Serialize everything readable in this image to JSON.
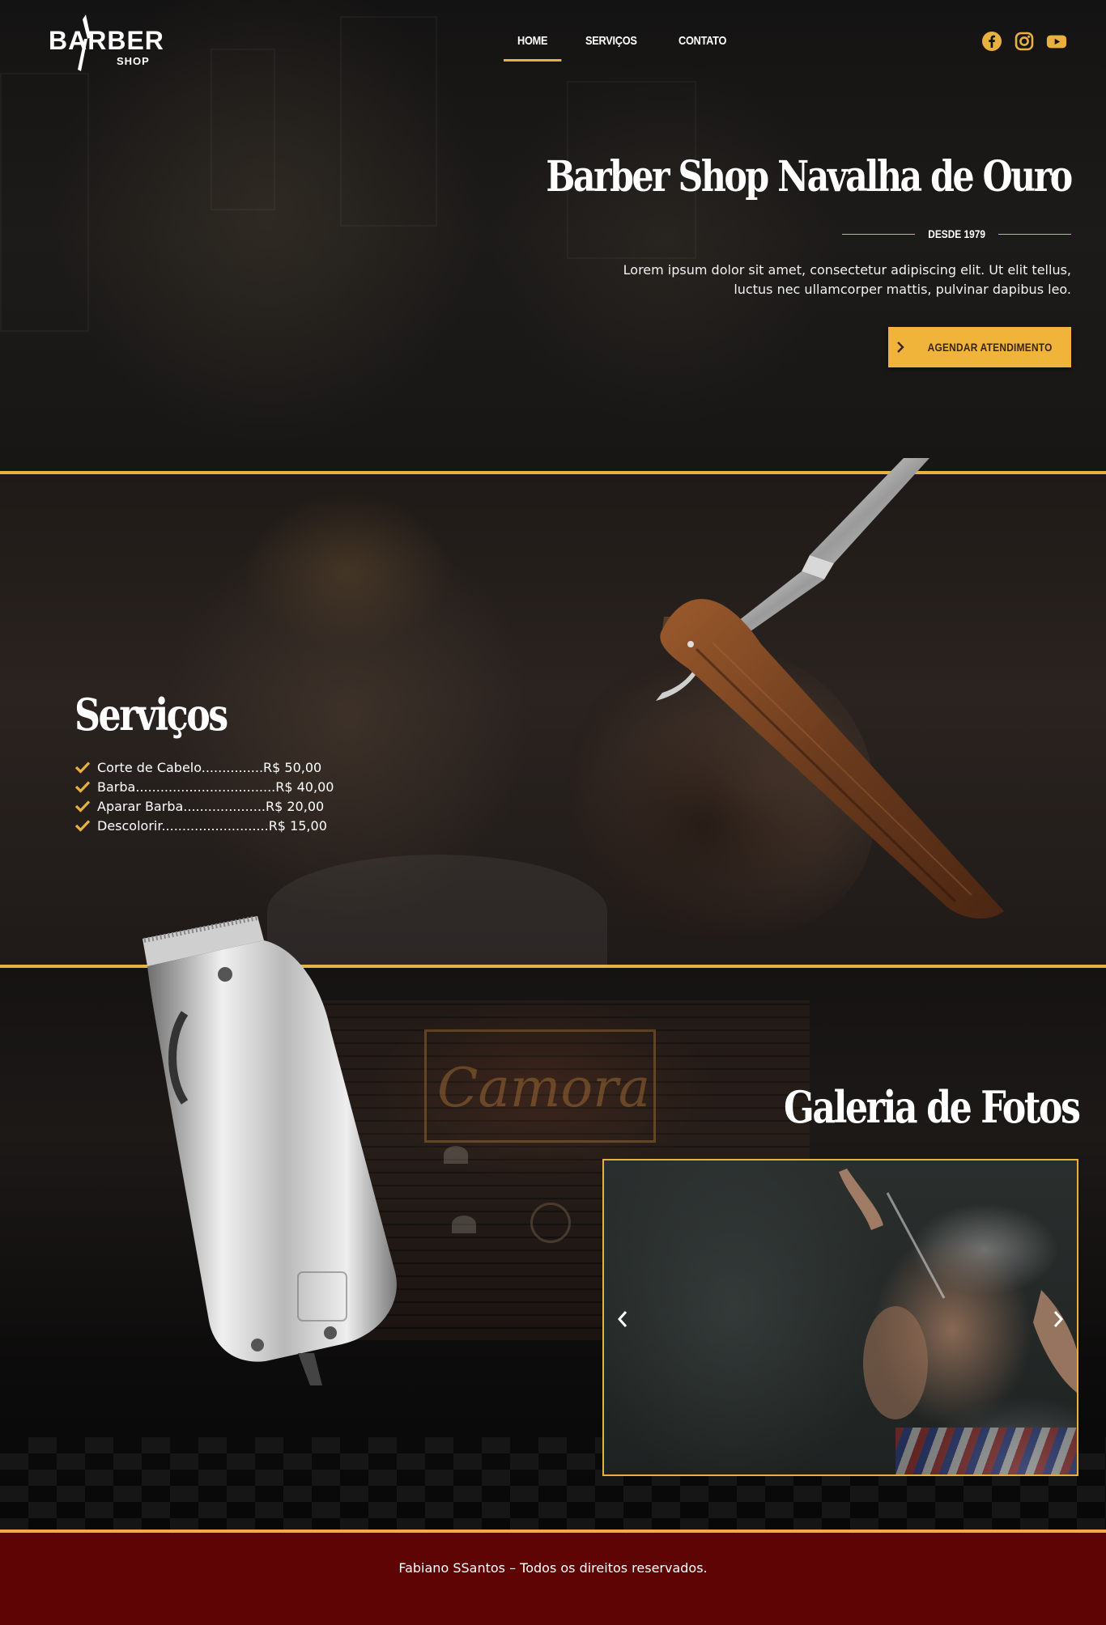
{
  "brand": {
    "logo_main": "BARBER",
    "logo_sub": "SHOP",
    "accent_color": "#e8b13f",
    "footer_color": "#5e0405"
  },
  "nav": {
    "items": [
      {
        "label": "HOME",
        "active": true
      },
      {
        "label": "SERVIÇOS",
        "active": false
      },
      {
        "label": "CONTATO",
        "active": false
      }
    ]
  },
  "socials": [
    {
      "icon": "facebook-icon"
    },
    {
      "icon": "instagram-icon"
    },
    {
      "icon": "youtube-icon"
    }
  ],
  "hero": {
    "title": "Barber Shop Navalha de Ouro",
    "since": "DESDE 1979",
    "description": "Lorem ipsum dolor sit amet, consectetur adipiscing elit. Ut elit tellus, luctus nec ullamcorper mattis, pulvinar dapibus leo.",
    "cta_label": "AGENDAR ATENDIMENTO"
  },
  "services": {
    "title": "Serviços",
    "items": [
      {
        "text": "Corte de Cabelo...............R$ 50,00"
      },
      {
        "text": "Barba..................................R$ 40,00"
      },
      {
        "text": "Aparar Barba....................R$ 20,00"
      },
      {
        "text": "Descolorir..........................R$ 15,00"
      }
    ]
  },
  "gallery": {
    "title": "Galeria de Fotos",
    "sign_text": "Camora"
  },
  "footer": {
    "text": "Fabiano SSantos – Todos os direitos reservados."
  }
}
